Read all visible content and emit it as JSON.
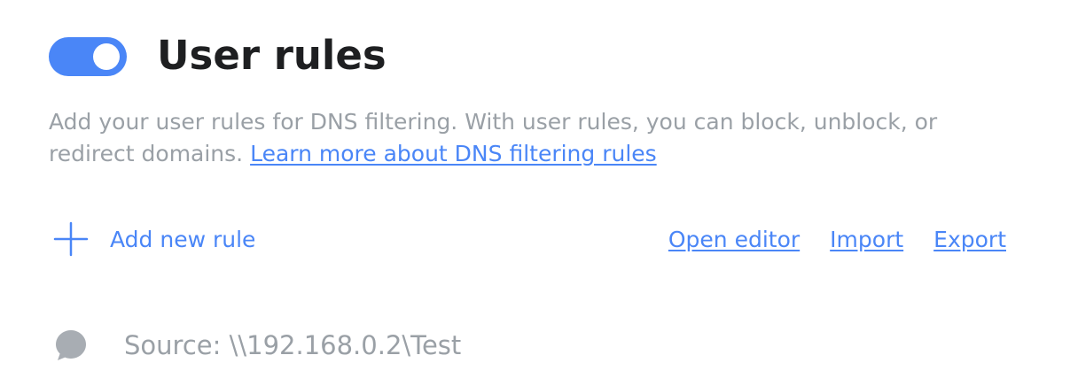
{
  "header": {
    "toggle_on": true,
    "title": "User rules"
  },
  "description": {
    "text": "Add your user rules for DNS filtering. With user rules, you can block, unblock, or redirect domains. ",
    "link_text": "Learn more about DNS filtering rules"
  },
  "toolbar": {
    "add_icon": "plus-icon",
    "add_label": "Add new rule",
    "open_editor_label": "Open editor",
    "import_label": "Import",
    "export_label": "Export"
  },
  "rules": [
    {
      "icon": "comment-icon",
      "text": "Source: \\\\192.168.0.2\\Test"
    }
  ],
  "colors": {
    "accent": "#4a86f7",
    "title": "#1e1f21",
    "muted": "#9aa0a6",
    "comment_icon": "#a8adb3"
  }
}
